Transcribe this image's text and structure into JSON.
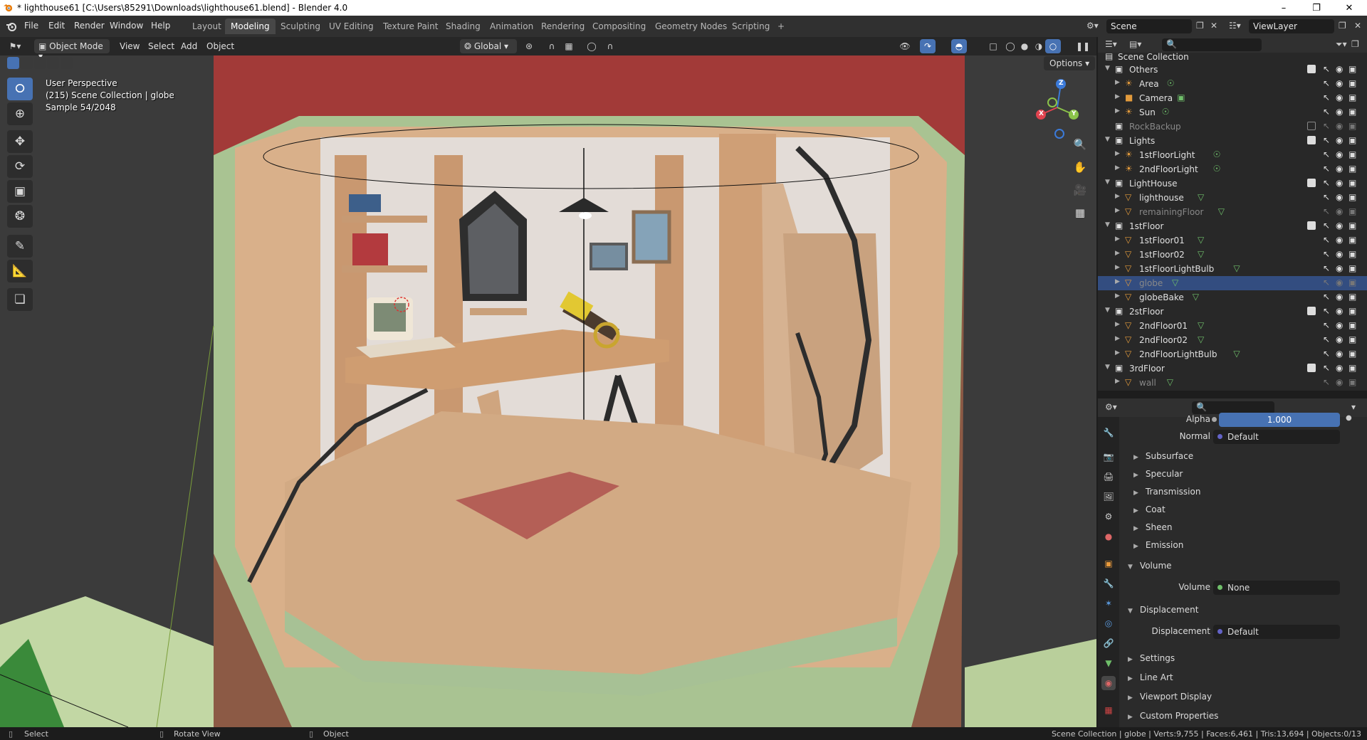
{
  "window": {
    "title": "* lighthouse61 [C:\\Users\\85291\\Downloads\\lighthouse61.blend] - Blender 4.0"
  },
  "menu": [
    "File",
    "Edit",
    "Render",
    "Window",
    "Help"
  ],
  "workspaces": [
    "Layout",
    "Modeling",
    "Sculpting",
    "UV Editing",
    "Texture Paint",
    "Shading",
    "Animation",
    "Rendering",
    "Compositing",
    "Geometry Nodes",
    "Scripting",
    "+"
  ],
  "active_workspace": "Modeling",
  "scene": {
    "name": "Scene",
    "view_layer": "ViewLayer"
  },
  "viewport_header": {
    "mode": "Object Mode",
    "view": "View",
    "select": "Select",
    "add": "Add",
    "object": "Object",
    "orientation": "Global",
    "options": "Options"
  },
  "overlay": {
    "line1": "User Perspective",
    "line2": "(215) Scene Collection | globe",
    "line3": "Sample 54/2048"
  },
  "gizmo": {
    "x": "X",
    "y": "Y",
    "z": "Z"
  },
  "outliner": {
    "root": "Scene Collection",
    "rows": [
      {
        "name": "Others",
        "type": "collection",
        "level": 0,
        "expanded": true,
        "checked": true
      },
      {
        "name": "Area",
        "type": "light",
        "level": 1
      },
      {
        "name": "Camera",
        "type": "camera",
        "level": 1
      },
      {
        "name": "Sun",
        "type": "light",
        "level": 1
      },
      {
        "name": "RockBackup",
        "type": "collection",
        "level": 0,
        "dim": true
      },
      {
        "name": "Lights",
        "type": "collection",
        "level": 0,
        "expanded": true,
        "checked": true
      },
      {
        "name": "1stFloorLight",
        "type": "light",
        "level": 1
      },
      {
        "name": "2ndFloorLight",
        "type": "light",
        "level": 1
      },
      {
        "name": "LightHouse",
        "type": "collection",
        "level": 0,
        "expanded": true,
        "checked": true
      },
      {
        "name": "lighthouse",
        "type": "mesh",
        "level": 1
      },
      {
        "name": "remainingFloor",
        "type": "mesh",
        "level": 1,
        "dim": true
      },
      {
        "name": "1stFloor",
        "type": "collection",
        "level": 0,
        "expanded": true,
        "checked": true
      },
      {
        "name": "1stFloor01",
        "type": "mesh",
        "level": 1
      },
      {
        "name": "1stFloor02",
        "type": "mesh",
        "level": 1
      },
      {
        "name": "1stFloorLightBulb",
        "type": "mesh",
        "level": 1
      },
      {
        "name": "globe",
        "type": "mesh",
        "level": 1,
        "selected": true,
        "dim": true
      },
      {
        "name": "globeBake",
        "type": "mesh",
        "level": 1
      },
      {
        "name": "2stFloor",
        "type": "collection",
        "level": 0,
        "expanded": true,
        "checked": true
      },
      {
        "name": "2ndFloor01",
        "type": "mesh",
        "level": 1
      },
      {
        "name": "2ndFloor02",
        "type": "mesh",
        "level": 1
      },
      {
        "name": "2ndFloorLightBulb",
        "type": "mesh",
        "level": 1
      },
      {
        "name": "3rdFloor",
        "type": "collection",
        "level": 0,
        "expanded": true,
        "checked": true
      },
      {
        "name": "wall",
        "type": "mesh",
        "level": 1,
        "dim": true
      }
    ]
  },
  "properties": {
    "alpha_label": "Alpha",
    "alpha_value": "1.000",
    "normal_label": "Normal",
    "normal_value": "Default",
    "subsections": [
      "Subsurface",
      "Specular",
      "Transmission",
      "Coat",
      "Sheen",
      "Emission"
    ],
    "volume_header": "Volume",
    "volume_label": "Volume",
    "volume_value": "None",
    "displacement_header": "Displacement",
    "displacement_label": "Displacement",
    "displacement_value": "Default",
    "panels": [
      "Settings",
      "Line Art",
      "Viewport Display",
      "Custom Properties"
    ]
  },
  "status": {
    "select": "Select",
    "rotate": "Rotate View",
    "object": "Object",
    "stats": "Scene Collection | globe | Verts:9,755 | Faces:6,461 | Tris:13,694 | Objects:0/13"
  },
  "colors": {
    "accent": "#4772b3",
    "selection": "#334d80",
    "mesh": "#e39b3c",
    "light": "#e39b3c",
    "data_green": "#6fbf6a",
    "collection": "#e0e0e0"
  }
}
